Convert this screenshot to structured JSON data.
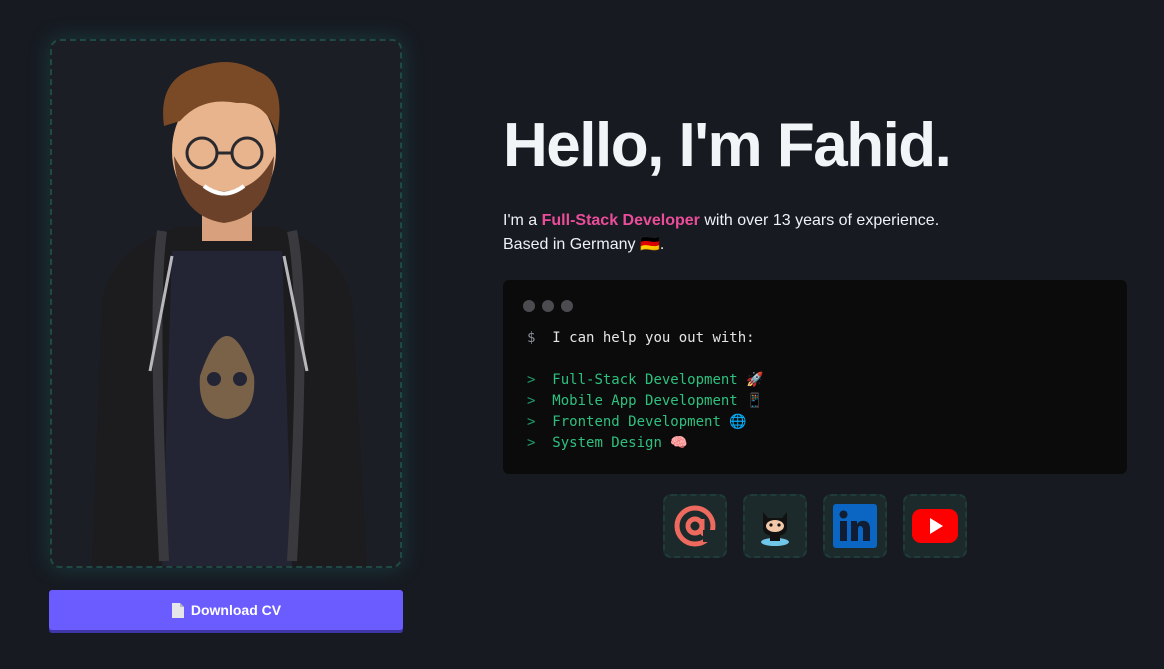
{
  "hero": {
    "title": "Hello, I'm Fahid.",
    "intro_prefix": "I'm a ",
    "intro_role": "Full-Stack Developer",
    "intro_suffix": " with over 13 years of experience.",
    "location_line": "Based in Germany 🇩🇪."
  },
  "download": {
    "label": "Download CV",
    "icon": "document-icon"
  },
  "terminal": {
    "prompt": "$",
    "command": "I can help you out with:",
    "marker": ">",
    "items": [
      "Full-Stack Development 🚀",
      "Mobile App Development 📱",
      "Frontend Development 🌐",
      "System Design 🧠"
    ]
  },
  "socials": [
    {
      "name": "email",
      "icon": "at-sign-icon"
    },
    {
      "name": "github",
      "icon": "github-octocat-icon"
    },
    {
      "name": "linkedin",
      "icon": "linkedin-icon"
    },
    {
      "name": "youtube",
      "icon": "youtube-icon"
    }
  ],
  "colors": {
    "background": "#171a21",
    "accent_pink": "#ec4d9a",
    "button": "#6a5cff",
    "terminal_green": "#2fc07e"
  }
}
